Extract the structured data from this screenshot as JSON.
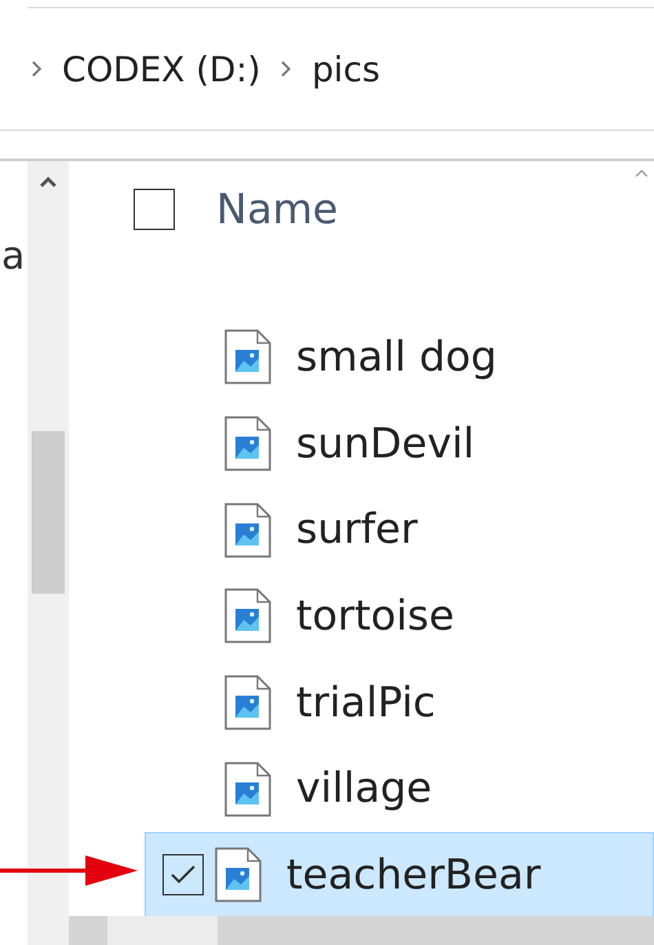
{
  "breadcrumb": [
    {
      "label": "CODEX (D:)"
    },
    {
      "label": "pics"
    }
  ],
  "nav_pane": {
    "text": "a"
  },
  "column_header": {
    "label": "Name",
    "checked": false
  },
  "files": [
    {
      "name": "small dog",
      "selected": false,
      "checked": false
    },
    {
      "name": "sunDevil",
      "selected": false,
      "checked": false
    },
    {
      "name": "surfer",
      "selected": false,
      "checked": false
    },
    {
      "name": "tortoise",
      "selected": false,
      "checked": false
    },
    {
      "name": "trialPic",
      "selected": false,
      "checked": false
    },
    {
      "name": "village",
      "selected": false,
      "checked": false
    },
    {
      "name": "teacherBear",
      "selected": true,
      "checked": true
    }
  ]
}
